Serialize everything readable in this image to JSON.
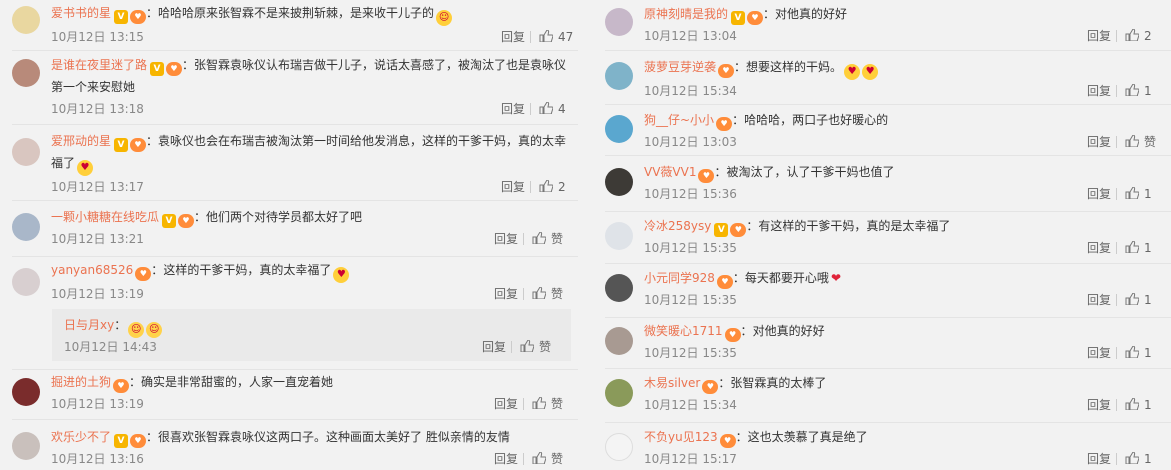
{
  "labels": {
    "reply": "回复",
    "like": "赞"
  },
  "left": [
    {
      "name": "爱书书的星",
      "text": "哈哈哈原来张智霖不是来披荆斩棘，是来收干儿子的",
      "time": "10月12日 13:15",
      "likes": "47",
      "avatar_color": "#e9d7a0"
    },
    {
      "name": "是谁在夜里迷了路",
      "text": "张智霖袁咏仪认布瑞吉做干儿子，说话太喜感了，被淘汰了也是袁咏仪第一个来安慰她",
      "time": "10月12日 13:18",
      "likes": "4",
      "avatar_color": "#b88a7a"
    },
    {
      "name": "爱邢动的星",
      "text": "袁咏仪也会在布瑞吉被淘汰第一时间给他发消息，这样的干爹干妈，真的太幸福了",
      "time": "10月12日 13:17",
      "likes": "2",
      "avatar_color": "#d9c6c0"
    },
    {
      "name": "一颗小糖糖在线吃瓜",
      "text": "他们两个对待学员都太好了吧",
      "time": "10月12日 13:21",
      "likes": "赞",
      "avatar_color": "#a9b7c9"
    },
    {
      "name": "yanyan68526",
      "text": "这样的干爹干妈，真的太幸福了",
      "time": "10月12日 13:19",
      "likes": "赞",
      "avatar_color": "#d8cfd0"
    },
    {
      "name": "掘进的土狗",
      "text": "确实是非常甜蜜的，人家一直宠着她",
      "time": "10月12日 13:19",
      "likes": "赞",
      "avatar_color": "#7a2c2c"
    },
    {
      "name": "欢乐少不了",
      "text": "很喜欢张智霖袁咏仪这两口子。这种画面太美好了 胜似亲情的友情",
      "time": "10月12日 13:16",
      "likes": "赞",
      "avatar_color": "#c9c0bc"
    }
  ],
  "subreply": {
    "name": "日与月xy",
    "separator": "：",
    "time": "10月12日 14:43",
    "likes": "赞"
  },
  "right": [
    {
      "name": "原神刻晴是我的",
      "text": "对他真的好好",
      "time": "10月12日 13:04",
      "likes": "2",
      "avatar_color": "#c7b8c9"
    },
    {
      "name": "菠萝豆芽逆袭",
      "text": "想要这样的干妈。",
      "time": "10月12日 15:34",
      "likes": "1",
      "avatar_color": "#7fb3c9"
    },
    {
      "name": "狗__仔~小小",
      "text": "哈哈哈，两口子也好暖心的",
      "time": "10月12日 13:03",
      "likes": "赞",
      "avatar_color": "#5aa7cf"
    },
    {
      "name": "VV薇VV1",
      "text": "被淘汰了，认了干爹干妈也值了",
      "time": "10月12日 15:36",
      "likes": "1",
      "avatar_color": "#3d3a36"
    },
    {
      "name": "冷冰258ysy",
      "text": "有这样的干爹干妈，真的是太幸福了",
      "time": "10月12日 15:35",
      "likes": "1",
      "avatar_color": "#dfe3e8"
    },
    {
      "name": "小元同学928",
      "text": "每天都要开心哦",
      "time": "10月12日 15:35",
      "likes": "1",
      "avatar_color": "#555"
    },
    {
      "name": "微笑暖心1711",
      "text": "对他真的好好",
      "time": "10月12日 15:35",
      "likes": "1",
      "avatar_color": "#a89a92"
    },
    {
      "name": "木易silver",
      "text": "张智霖真的太棒了",
      "time": "10月12日 15:34",
      "likes": "1",
      "avatar_color": "#8a9a5a"
    },
    {
      "name": "不负yu见123",
      "text": "这也太羡慕了真是绝了",
      "time": "10月12日 15:17",
      "likes": "1",
      "avatar_color": "#f4f4f4"
    }
  ]
}
